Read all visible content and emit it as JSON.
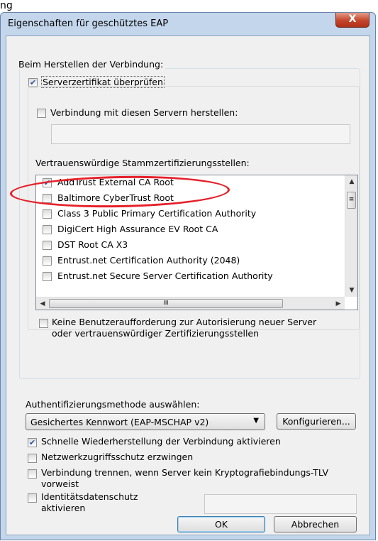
{
  "window": {
    "above_title": "ng",
    "title": "Eigenschaften für geschütztes EAP",
    "close_glyph": "X"
  },
  "connect_section": {
    "label": "Beim Herstellen der Verbindung:",
    "verify_cert": {
      "label": "Serverzertifikat überprüfen",
      "checked": true
    },
    "connect_servers": {
      "label": "Verbindung mit diesen Servern herstellen:",
      "checked": false,
      "value": ""
    },
    "trusted_ca_label": "Vertrauenswürdige Stammzertifizierungsstellen:",
    "ca_list": [
      {
        "label": "AddTrust External CA Root",
        "checked": true
      },
      {
        "label": "Baltimore CyberTrust Root",
        "checked": false
      },
      {
        "label": "Class 3 Public Primary Certification Authority",
        "checked": false
      },
      {
        "label": "DigiCert High Assurance EV Root CA",
        "checked": false
      },
      {
        "label": "DST Root CA X3",
        "checked": false
      },
      {
        "label": "Entrust.net Certification Authority (2048)",
        "checked": false
      },
      {
        "label": "Entrust.net Secure Server Certification Authority",
        "checked": false
      }
    ],
    "no_prompt": {
      "line1": "Keine Benutzeraufforderung zur Autorisierung neuer Server",
      "line2": "oder vertrauenswürdiger Zertifizierungsstellen",
      "checked": false
    }
  },
  "auth": {
    "label": "Authentifizierungsmethode auswählen:",
    "selected": "Gesichertes Kennwort (EAP-MSCHAP v2)",
    "configure_button": "Konfigurieren..."
  },
  "options": {
    "fast_reconnect": {
      "label": "Schnelle Wiederherstellung der Verbindung aktivieren",
      "checked": true
    },
    "nap": {
      "label": "Netzwerkzugriffsschutz erzwingen",
      "checked": false
    },
    "disconnect": {
      "line1": "Verbindung trennen, wenn Server kein Kryptografiebindungs-TLV",
      "line2": "vorweist",
      "checked": false
    },
    "identity_privacy": {
      "line1": "Identitätsdatenschutz",
      "line2": "aktivieren",
      "checked": false,
      "value": ""
    }
  },
  "buttons": {
    "ok": "OK",
    "cancel": "Abbrechen"
  },
  "annotation": {
    "color": "#e6202a"
  },
  "colors": {
    "title_bg": "#c3d6ec",
    "client_bg": "#f0f0f0",
    "close_red": "#c3452b"
  }
}
